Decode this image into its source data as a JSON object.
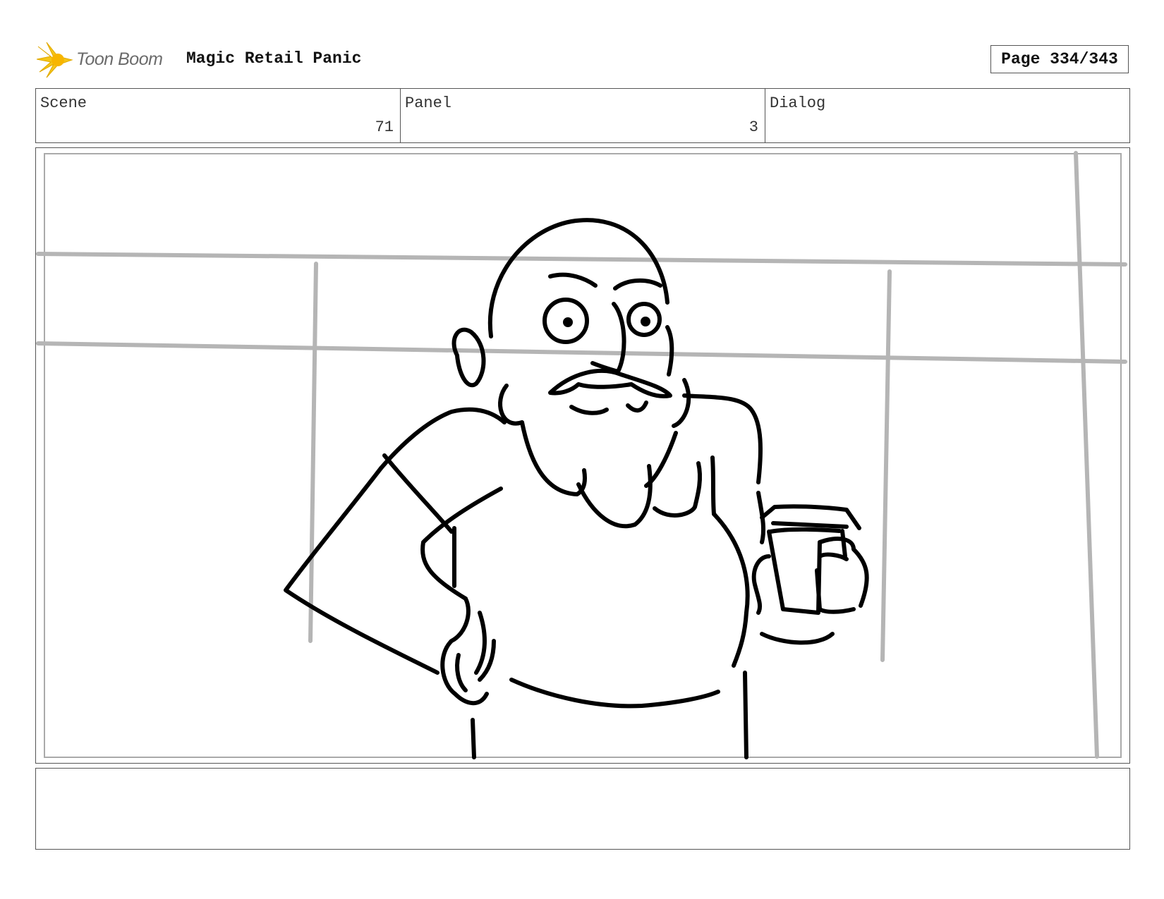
{
  "header": {
    "logo_text": "Toon Boom",
    "project_title": "Magic Retail Panic",
    "page_label": "Page 334/343"
  },
  "info": {
    "scene_label": "Scene",
    "scene_value": "71",
    "panel_label": "Panel",
    "panel_value": "3",
    "dialog_label": "Dialog",
    "dialog_value": ""
  },
  "notes": {
    "text": ""
  }
}
